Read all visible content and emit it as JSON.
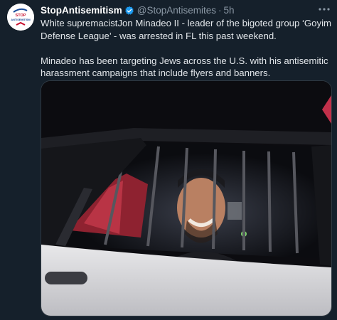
{
  "tweet": {
    "display_name": "StopAntisemitism",
    "handle": "@StopAntisemites",
    "separator": "·",
    "time": "5h",
    "paragraphs": [
      "White supremacistJon Minadeo II - leader of the bigoted group ‘Goyim Defense League’ - was arrested in FL this past weekend.",
      "Minadeo has been targeting Jews across the U.S. with his antisemitic harassment campaigns that include flyers and banners."
    ]
  },
  "avatar": {
    "logo_text": [
      "STOP",
      "ANTISEMITISM"
    ],
    "accent": "#c8102e",
    "secondary": "#1a4c9a"
  },
  "icons": {
    "verified": "verified-badge-icon",
    "more": "more-options-icon"
  },
  "colors": {
    "background": "#15202b",
    "name": "#ffffff",
    "secondary_text": "#8b98a5",
    "verified": "#1d9bf0"
  },
  "media": {
    "description_name": "police-car-photo"
  }
}
